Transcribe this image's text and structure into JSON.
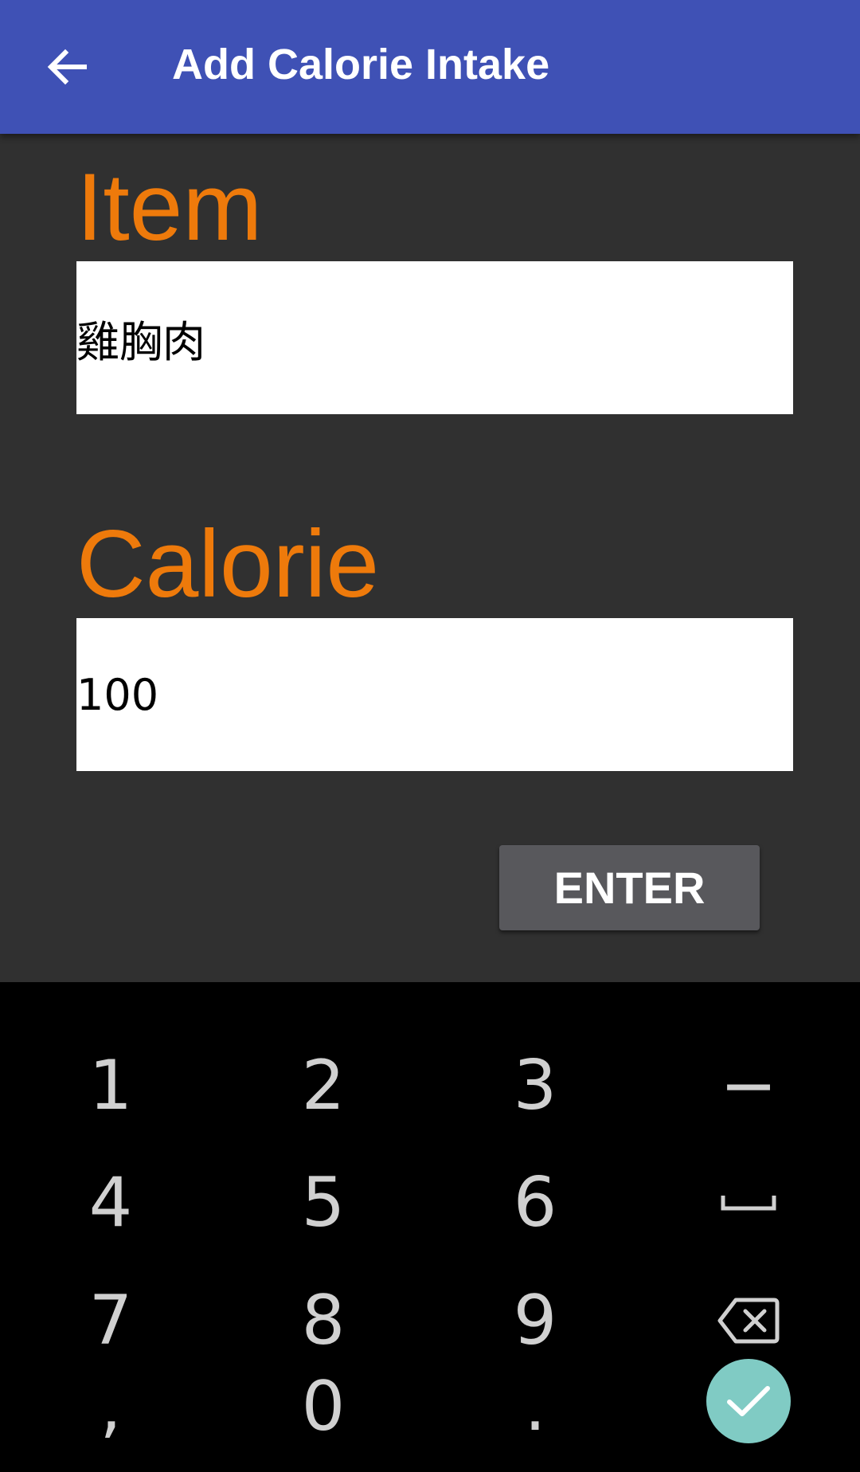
{
  "appbar": {
    "title": "Add Calorie Intake",
    "back_icon": "arrow-back-icon",
    "color": "#3F51B5"
  },
  "form": {
    "item_label": "Item",
    "item_value": "雞胸肉",
    "calorie_label": "Calorie",
    "calorie_value": "100",
    "label_color": "#EE7A0B"
  },
  "enter_button": {
    "label": "ENTER"
  },
  "keyboard": {
    "keys": [
      "1",
      "2",
      "3",
      "−",
      "4",
      "5",
      "6",
      "space",
      "7",
      "8",
      "9",
      "backspace",
      ",",
      "0",
      ".",
      "done"
    ],
    "space_icon": "space-bar-icon",
    "backspace_icon": "backspace-icon",
    "done_icon": "checkmark-icon",
    "done_color": "#80CBC4"
  }
}
